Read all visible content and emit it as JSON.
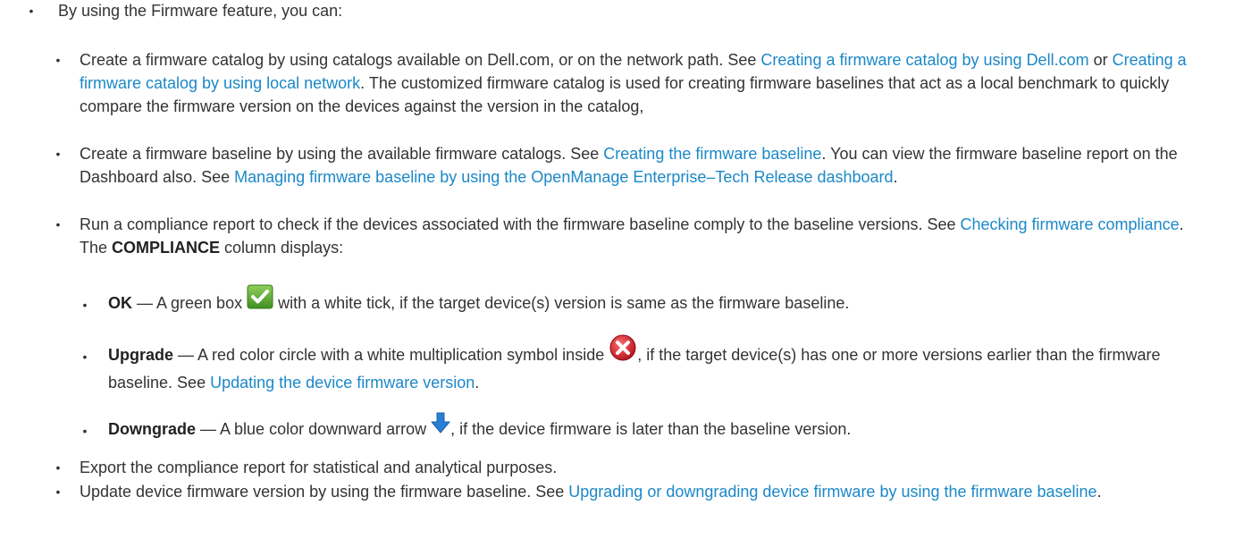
{
  "intro": "By using the Firmware feature, you can:",
  "items": {
    "catalog": {
      "t1": "Create a firmware catalog by using catalogs available on Dell.com, or on the network path. See ",
      "link1": "Creating a firmware catalog by using Dell.com",
      "t2": " or ",
      "link2": "Creating a firmware catalog by using local network",
      "t3": ". The customized firmware catalog is used for creating firmware baselines that act as a local benchmark to quickly compare the firmware version on the devices against the version in the catalog,"
    },
    "baseline": {
      "t1": "Create a firmware baseline by using the available firmware catalogs. See ",
      "link1": "Creating the firmware baseline",
      "t2": ". You can view the firmware baseline report on the Dashboard also. See ",
      "link2": "Managing firmware baseline by using the OpenManage Enterprise–Tech Release dashboard",
      "t3": "."
    },
    "compliance": {
      "t1": "Run a compliance report to check if the devices associated with the firmware baseline comply to the baseline versions. See ",
      "link1": "Checking firmware compliance",
      "t2": ". The ",
      "bold": "COMPLIANCE",
      "t3": " column displays:"
    },
    "ok": {
      "bold": "OK",
      "t1": " — A green box ",
      "t2": " with a white tick, if the target device(s) version is same as the firmware baseline."
    },
    "upgrade": {
      "bold": "Upgrade",
      "t1": " — A red color circle with a white multiplication symbol inside ",
      "t2": ", if the target device(s) has one or more versions earlier than the firmware baseline. See ",
      "link1": "Updating the device firmware version",
      "t3": "."
    },
    "downgrade": {
      "bold": "Downgrade",
      "t1": " — A blue color downward arrow ",
      "t2": ", if the device firmware is later than the baseline version."
    },
    "export": "Export the compliance report for statistical and analytical purposes.",
    "update": {
      "t1": "Update device firmware version by using the firmware baseline. See ",
      "link1": "Upgrading or downgrading device firmware by using the firmware baseline",
      "t2": "."
    }
  },
  "bullet_char": "•",
  "icons": {
    "ok": "green-check-box-icon",
    "upgrade": "red-x-circle-icon",
    "downgrade": "blue-down-arrow-icon"
  },
  "colors": {
    "link": "#1b88c7",
    "text": "#333333",
    "ok_green": "#5aa832",
    "upgrade_red": "#d0202c",
    "downgrade_blue": "#2a7fd4"
  }
}
